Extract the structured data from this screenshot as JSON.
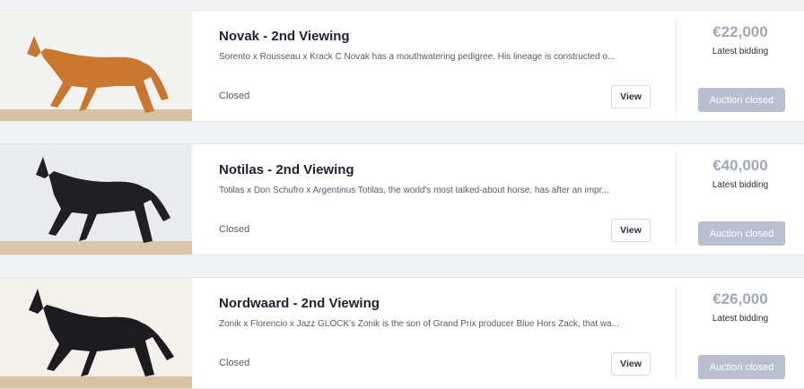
{
  "listings": [
    {
      "title": "Novak - 2nd Viewing",
      "description": "Sorento x Rousseau x Krack C Novak has a mouthwatering pedigree. His lineage is constructed o...",
      "status": "Closed",
      "view_label": "View",
      "price": "€22,000",
      "price_label": "Latest bidding",
      "auction_label": "Auction closed",
      "horse_color": "#c9762f"
    },
    {
      "title": "Notilas - 2nd Viewing",
      "description": "Totilas x Don Schufro x Argentinus Totilas, the world's most talked-about horse, has after an impr...",
      "status": "Closed",
      "view_label": "View",
      "price": "€40,000",
      "price_label": "Latest bidding",
      "auction_label": "Auction closed",
      "horse_color": "#1f1f24"
    },
    {
      "title": "Nordwaard - 2nd Viewing",
      "description": "Zonik x Florencio x Jazz GLOCK's Zonik is the son of Grand Prix producer Blue Hors Zack, that wa...",
      "status": "Closed",
      "view_label": "View",
      "price": "€26,000",
      "price_label": "Latest bidding",
      "auction_label": "Auction closed",
      "horse_color": "#1c1b20"
    }
  ]
}
